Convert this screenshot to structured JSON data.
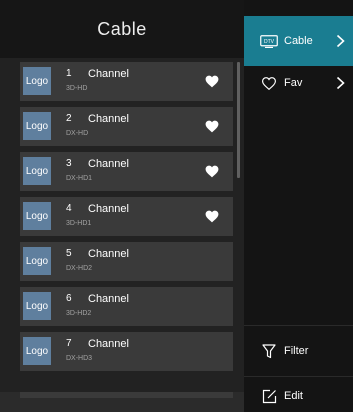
{
  "panel": {
    "title": "Cable"
  },
  "logo_text": "Logo",
  "channels": [
    {
      "number": "1",
      "name": "Channel",
      "sub": "3D-HD",
      "favorite": true
    },
    {
      "number": "2",
      "name": "Channel",
      "sub": "DX-HD",
      "favorite": true
    },
    {
      "number": "3",
      "name": "Channel",
      "sub": "DX-HD1",
      "favorite": true
    },
    {
      "number": "4",
      "name": "Channel",
      "sub": "3D-HD1",
      "favorite": true
    },
    {
      "number": "5",
      "name": "Channel",
      "sub": "DX-HD2",
      "favorite": false
    },
    {
      "number": "6",
      "name": "Channel",
      "sub": "3D-HD2",
      "favorite": false
    },
    {
      "number": "7",
      "name": "Channel",
      "sub": "DX-HD3",
      "favorite": false
    }
  ],
  "menu": {
    "cable_label": "Cable",
    "fav_label": "Fav",
    "filter_label": "Filter",
    "edit_label": "Edit"
  },
  "colors": {
    "accent": "#1a7d91",
    "logo_bg": "#5f7f9e",
    "row_bg": "#3a3a3a"
  },
  "icons": {
    "cable": "tv-icon",
    "fav": "heart-outline-icon",
    "filter": "filter-icon",
    "edit": "edit-icon",
    "favorite_mark": "heart-filled-icon"
  }
}
